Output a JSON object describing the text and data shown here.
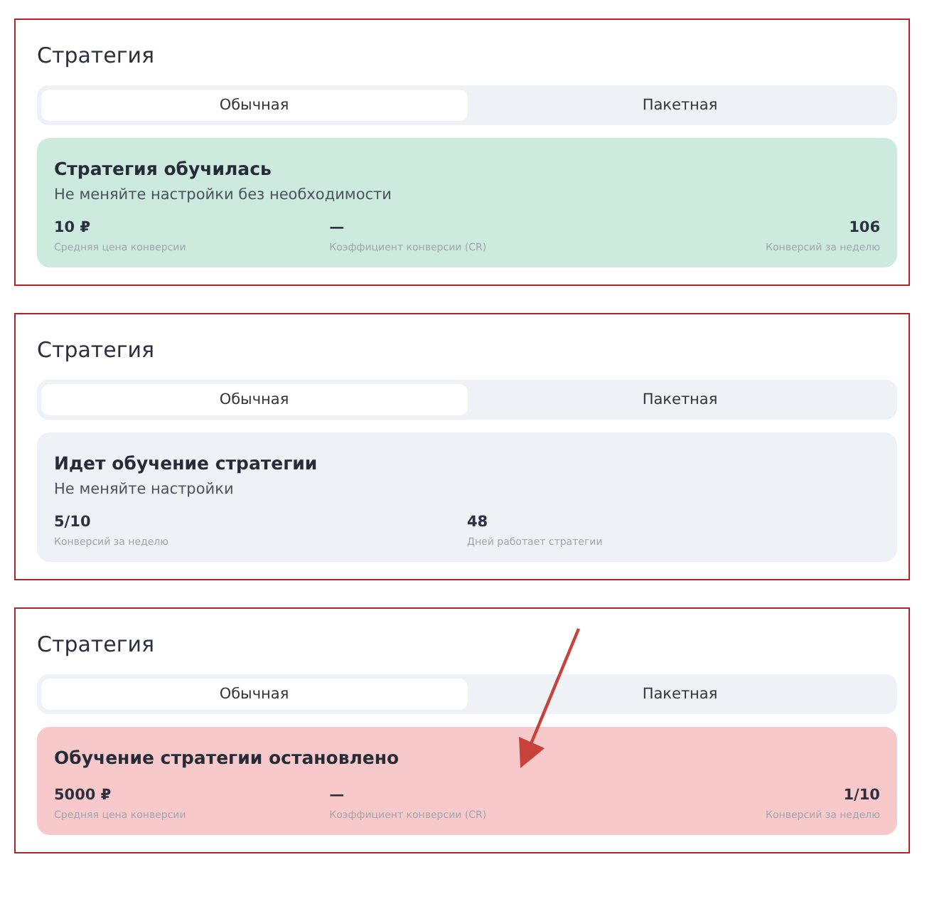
{
  "panels": [
    {
      "title": "Стратегия",
      "tabs": [
        {
          "label": "Обычная",
          "selected": true
        },
        {
          "label": "Пакетная",
          "selected": false
        }
      ],
      "status": {
        "kind": "learned",
        "title": "Стратегия обучилась",
        "subtitle": "Не меняйте настройки без необходимости",
        "metrics": [
          {
            "value": "10 ₽",
            "label": "Средняя цена конверсии"
          },
          {
            "value": "—",
            "label": "Коэффициент конверсии (CR)"
          },
          {
            "value": "106",
            "label": "Конверсий за неделю"
          }
        ]
      }
    },
    {
      "title": "Стратегия",
      "tabs": [
        {
          "label": "Обычная",
          "selected": true
        },
        {
          "label": "Пакетная",
          "selected": false
        }
      ],
      "status": {
        "kind": "learning",
        "title": "Идет обучение стратегии",
        "subtitle": "Не меняйте настройки",
        "metrics": [
          {
            "value": "5/10",
            "label": "Конверсий за неделю"
          },
          {
            "value": "48",
            "label": "Дней работает стратегии"
          }
        ]
      }
    },
    {
      "title": "Стратегия",
      "tabs": [
        {
          "label": "Обычная",
          "selected": true
        },
        {
          "label": "Пакетная",
          "selected": false
        }
      ],
      "status": {
        "kind": "stopped",
        "title": "Обучение стратегии остановлено",
        "metrics": [
          {
            "value": "5000 ₽",
            "label": "Средняя цена конверсии"
          },
          {
            "value": "—",
            "label": "Коэффициент конверсии (CR)"
          },
          {
            "value": "1/10",
            "label": "Конверсий за неделю"
          }
        ]
      },
      "annotation": {
        "kind": "arrow"
      }
    }
  ]
}
